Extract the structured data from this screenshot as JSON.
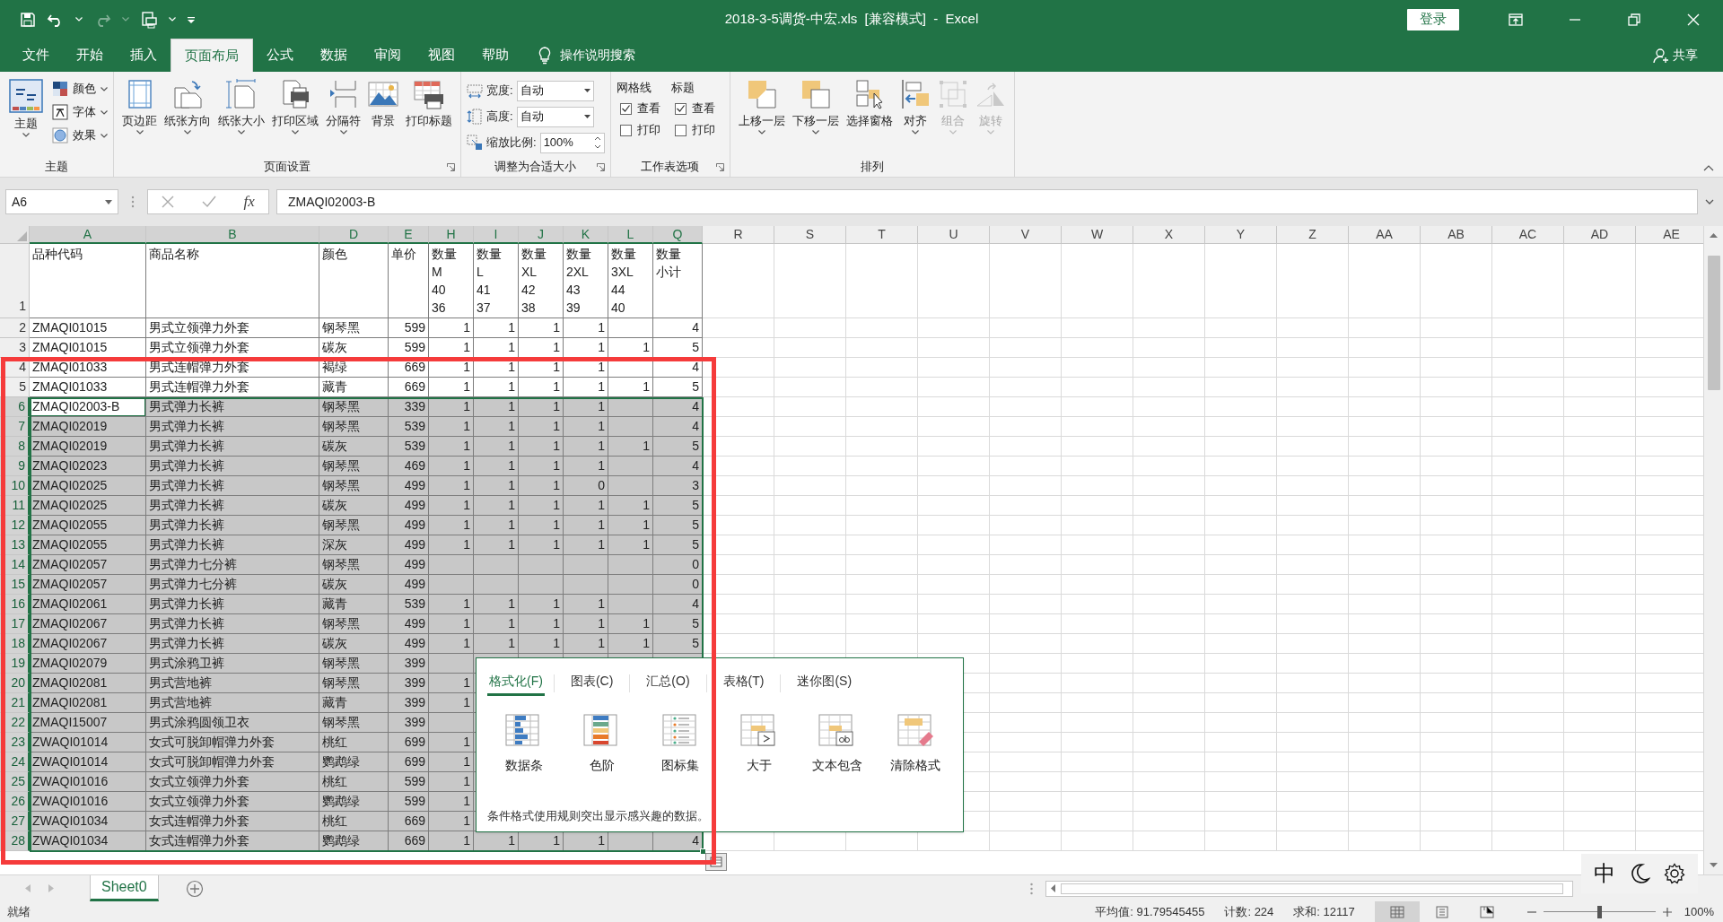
{
  "title_bar": {
    "title": "2018-3-5调货-中宏.xls  [兼容模式]  -  Excel",
    "sign_in": "登录"
  },
  "menu_tabs": [
    {
      "label": "文件",
      "selected": false
    },
    {
      "label": "开始",
      "selected": false
    },
    {
      "label": "插入",
      "selected": false
    },
    {
      "label": "页面布局",
      "selected": true
    },
    {
      "label": "公式",
      "selected": false
    },
    {
      "label": "数据",
      "selected": false
    },
    {
      "label": "审阅",
      "selected": false
    },
    {
      "label": "视图",
      "selected": false
    },
    {
      "label": "帮助",
      "selected": false
    }
  ],
  "tell_me": "操作说明搜索",
  "share": "共享",
  "ribbon": {
    "groups": [
      {
        "label": "主题",
        "kind": "theme",
        "launcher": false,
        "large": "主题",
        "small": [
          {
            "label": "颜色"
          },
          {
            "label": "字体"
          },
          {
            "label": "效果"
          }
        ]
      },
      {
        "label": "页面设置",
        "kind": "buttons",
        "launcher": true,
        "buttons": [
          {
            "label": "页边距",
            "dropdown": true,
            "disabled": false
          },
          {
            "label": "纸张方向",
            "dropdown": true,
            "disabled": false
          },
          {
            "label": "纸张大小",
            "dropdown": true,
            "disabled": false
          },
          {
            "label": "打印区域",
            "dropdown": true,
            "disabled": false
          },
          {
            "label": "分隔符",
            "dropdown": true,
            "disabled": false
          },
          {
            "label": "背景",
            "dropdown": false,
            "disabled": false
          },
          {
            "label": "打印标题",
            "dropdown": false,
            "disabled": false
          }
        ]
      },
      {
        "label": "调整为合适大小",
        "kind": "scale",
        "launcher": true,
        "fields": [
          {
            "label": "宽度:",
            "value": "自动",
            "kind": "dropdown"
          },
          {
            "label": "高度:",
            "value": "自动",
            "kind": "dropdown"
          },
          {
            "label": "缩放比例:",
            "value": "100%",
            "kind": "spinner"
          }
        ]
      },
      {
        "label": "工作表选项",
        "kind": "sheet_options",
        "launcher": true,
        "columns": [
          {
            "heading": "网格线",
            "options": [
              {
                "label": "查看",
                "checked": true
              },
              {
                "label": "打印",
                "checked": false
              }
            ]
          },
          {
            "heading": "标题",
            "options": [
              {
                "label": "查看",
                "checked": true
              },
              {
                "label": "打印",
                "checked": false
              }
            ]
          }
        ]
      },
      {
        "label": "排列",
        "kind": "buttons",
        "launcher": false,
        "buttons": [
          {
            "label": "上移一层",
            "dropdown": true,
            "disabled": false
          },
          {
            "label": "下移一层",
            "dropdown": true,
            "disabled": false
          },
          {
            "label": "选择窗格",
            "dropdown": false,
            "disabled": false
          },
          {
            "label": "对齐",
            "dropdown": true,
            "disabled": false
          },
          {
            "label": "组合",
            "dropdown": true,
            "disabled": true
          },
          {
            "label": "旋转",
            "dropdown": true,
            "disabled": true
          }
        ]
      }
    ]
  },
  "formula_bar": {
    "name_box": "A6",
    "function_symbol": "fx",
    "content": "ZMAQI02003-B"
  },
  "grid": {
    "columns": [
      {
        "letter": "A",
        "selected": true
      },
      {
        "letter": "B",
        "selected": true
      },
      {
        "letter": "D",
        "selected": true
      },
      {
        "letter": "E",
        "selected": true
      },
      {
        "letter": "H",
        "selected": true
      },
      {
        "letter": "I",
        "selected": true
      },
      {
        "letter": "J",
        "selected": true
      },
      {
        "letter": "K",
        "selected": true
      },
      {
        "letter": "L",
        "selected": true
      },
      {
        "letter": "Q",
        "selected": true
      },
      {
        "letter": "R",
        "selected": false
      },
      {
        "letter": "S",
        "selected": false
      },
      {
        "letter": "T",
        "selected": false
      },
      {
        "letter": "U",
        "selected": false
      },
      {
        "letter": "V",
        "selected": false
      },
      {
        "letter": "W",
        "selected": false
      },
      {
        "letter": "X",
        "selected": false
      },
      {
        "letter": "Y",
        "selected": false
      },
      {
        "letter": "Z",
        "selected": false
      },
      {
        "letter": "AA",
        "selected": false
      },
      {
        "letter": "AB",
        "selected": false
      },
      {
        "letter": "AC",
        "selected": false
      },
      {
        "letter": "AD",
        "selected": false
      },
      {
        "letter": "AE",
        "selected": false
      }
    ],
    "rows": [
      {
        "number": "1",
        "kind": "header",
        "selected": false,
        "active": false,
        "cells": [
          "品种代码",
          "商品名称",
          "颜色",
          "单价",
          "数量\nM\n40\n36",
          "数量\nL\n41\n37",
          "数量\nXL\n42\n38",
          "数量\n2XL\n43\n39",
          "数量\n3XL\n44\n40",
          "数量小计"
        ]
      },
      {
        "number": "2",
        "kind": "data",
        "selected": false,
        "active": false,
        "cells": [
          "ZMAQI01015",
          "男式立领弹力外套",
          "钢琴黑",
          "599",
          "1",
          "1",
          "1",
          "1",
          null,
          "4"
        ]
      },
      {
        "number": "3",
        "kind": "data",
        "selected": false,
        "active": false,
        "cells": [
          "ZMAQI01015",
          "男式立领弹力外套",
          "碳灰",
          "599",
          "1",
          "1",
          "1",
          "1",
          "1",
          "5"
        ]
      },
      {
        "number": "4",
        "kind": "data",
        "selected": false,
        "active": false,
        "cells": [
          "ZMAQI01033",
          "男式连帽弹力外套",
          "褐绿",
          "669",
          "1",
          "1",
          "1",
          "1",
          null,
          "4"
        ]
      },
      {
        "number": "5",
        "kind": "data",
        "selected": false,
        "active": false,
        "cells": [
          "ZMAQI01033",
          "男式连帽弹力外套",
          "藏青",
          "669",
          "1",
          "1",
          "1",
          "1",
          "1",
          "5"
        ]
      },
      {
        "number": "6",
        "kind": "data",
        "selected": true,
        "active": true,
        "cells": [
          "ZMAQI02003-B",
          "男式弹力长裤",
          "钢琴黑",
          "339",
          "1",
          "1",
          "1",
          "1",
          null,
          "4"
        ]
      },
      {
        "number": "7",
        "kind": "data",
        "selected": true,
        "active": false,
        "cells": [
          "ZMAQI02019",
          "男式弹力长裤",
          "钢琴黑",
          "539",
          "1",
          "1",
          "1",
          "1",
          null,
          "4"
        ]
      },
      {
        "number": "8",
        "kind": "data",
        "selected": true,
        "active": false,
        "cells": [
          "ZMAQI02019",
          "男式弹力长裤",
          "碳灰",
          "539",
          "1",
          "1",
          "1",
          "1",
          "1",
          "5"
        ]
      },
      {
        "number": "9",
        "kind": "data",
        "selected": true,
        "active": false,
        "cells": [
          "ZMAQI02023",
          "男式弹力长裤",
          "钢琴黑",
          "469",
          "1",
          "1",
          "1",
          "1",
          null,
          "4"
        ]
      },
      {
        "number": "10",
        "kind": "data",
        "selected": true,
        "active": false,
        "cells": [
          "ZMAQI02025",
          "男式弹力长裤",
          "钢琴黑",
          "499",
          "1",
          "1",
          "1",
          "0",
          null,
          "3"
        ]
      },
      {
        "number": "11",
        "kind": "data",
        "selected": true,
        "active": false,
        "cells": [
          "ZMAQI02025",
          "男式弹力长裤",
          "碳灰",
          "499",
          "1",
          "1",
          "1",
          "1",
          "1",
          "5"
        ]
      },
      {
        "number": "12",
        "kind": "data",
        "selected": true,
        "active": false,
        "cells": [
          "ZMAQI02055",
          "男式弹力长裤",
          "钢琴黑",
          "499",
          "1",
          "1",
          "1",
          "1",
          "1",
          "5"
        ]
      },
      {
        "number": "13",
        "kind": "data",
        "selected": true,
        "active": false,
        "cells": [
          "ZMAQI02055",
          "男式弹力长裤",
          "深灰",
          "499",
          "1",
          "1",
          "1",
          "1",
          "1",
          "5"
        ]
      },
      {
        "number": "14",
        "kind": "data",
        "selected": true,
        "active": false,
        "cells": [
          "ZMAQI02057",
          "男式弹力七分裤",
          "钢琴黑",
          "499",
          null,
          null,
          null,
          null,
          null,
          "0"
        ]
      },
      {
        "number": "15",
        "kind": "data",
        "selected": true,
        "active": false,
        "cells": [
          "ZMAQI02057",
          "男式弹力七分裤",
          "碳灰",
          "499",
          null,
          null,
          null,
          null,
          null,
          "0"
        ]
      },
      {
        "number": "16",
        "kind": "data",
        "selected": true,
        "active": false,
        "cells": [
          "ZMAQI02061",
          "男式弹力长裤",
          "藏青",
          "539",
          "1",
          "1",
          "1",
          "1",
          null,
          "4"
        ]
      },
      {
        "number": "17",
        "kind": "data",
        "selected": true,
        "active": false,
        "cells": [
          "ZMAQI02067",
          "男式弹力长裤",
          "钢琴黑",
          "499",
          "1",
          "1",
          "1",
          "1",
          "1",
          "5"
        ]
      },
      {
        "number": "18",
        "kind": "data",
        "selected": true,
        "active": false,
        "cells": [
          "ZMAQI02067",
          "男式弹力长裤",
          "碳灰",
          "499",
          "1",
          "1",
          "1",
          "1",
          "1",
          "5"
        ]
      },
      {
        "number": "19",
        "kind": "data",
        "selected": true,
        "active": false,
        "cells": [
          "ZMAQI02079",
          "男式涂鸦卫裤",
          "钢琴黑",
          "399",
          null,
          null,
          null,
          null,
          null,
          null
        ]
      },
      {
        "number": "20",
        "kind": "data",
        "selected": true,
        "active": false,
        "cells": [
          "ZMAQI02081",
          "男式营地裤",
          "钢琴黑",
          "399",
          "1",
          null,
          null,
          null,
          null,
          null
        ]
      },
      {
        "number": "21",
        "kind": "data",
        "selected": true,
        "active": false,
        "cells": [
          "ZMAQI02081",
          "男式营地裤",
          "藏青",
          "399",
          "1",
          null,
          null,
          null,
          null,
          null
        ]
      },
      {
        "number": "22",
        "kind": "data",
        "selected": true,
        "active": false,
        "cells": [
          "ZMAQI15007",
          "男式涂鸦圆领卫衣",
          "钢琴黑",
          "399",
          null,
          null,
          null,
          null,
          null,
          null
        ]
      },
      {
        "number": "23",
        "kind": "data",
        "selected": true,
        "active": false,
        "cells": [
          "ZWAQI01014",
          "女式可脱卸帽弹力外套",
          "桃红",
          "699",
          "1",
          null,
          null,
          null,
          null,
          null
        ]
      },
      {
        "number": "24",
        "kind": "data",
        "selected": true,
        "active": false,
        "cells": [
          "ZWAQI01014",
          "女式可脱卸帽弹力外套",
          "鹦鹉绿",
          "699",
          "1",
          null,
          null,
          null,
          null,
          null
        ]
      },
      {
        "number": "25",
        "kind": "data",
        "selected": true,
        "active": false,
        "cells": [
          "ZWAQI01016",
          "女式立领弹力外套",
          "桃红",
          "599",
          "1",
          null,
          null,
          null,
          null,
          null
        ]
      },
      {
        "number": "26",
        "kind": "data",
        "selected": true,
        "active": false,
        "cells": [
          "ZWAQI01016",
          "女式立领弹力外套",
          "鹦鹉绿",
          "599",
          "1",
          null,
          null,
          null,
          null,
          null
        ]
      },
      {
        "number": "27",
        "kind": "data",
        "selected": true,
        "active": false,
        "cells": [
          "ZWAQI01034",
          "女式连帽弹力外套",
          "桃红",
          "669",
          "1",
          null,
          null,
          null,
          null,
          null
        ]
      },
      {
        "number": "28",
        "kind": "data",
        "selected": true,
        "active": false,
        "cells": [
          "ZWAQI01034",
          "女式连帽弹力外套",
          "鹦鹉绿",
          "669",
          "1",
          "1",
          "1",
          "1",
          null,
          "4"
        ]
      }
    ]
  },
  "quick_analysis": {
    "tabs": [
      {
        "label": "格式化(F)",
        "selected": true
      },
      {
        "label": "图表(C)",
        "selected": false
      },
      {
        "label": "汇总(O)",
        "selected": false
      },
      {
        "label": "表格(T)",
        "selected": false
      },
      {
        "label": "迷你图(S)",
        "selected": false
      }
    ],
    "items": [
      {
        "label": "数据条"
      },
      {
        "label": "色阶"
      },
      {
        "label": "图标集"
      },
      {
        "label": "大于"
      },
      {
        "label": "文本包含"
      },
      {
        "label": "清除格式"
      }
    ],
    "description": "条件格式使用规则突出显示感兴趣的数据。"
  },
  "sheet_tabs": [
    {
      "label": "Sheet0",
      "selected": true
    }
  ],
  "ime": {
    "mode": "中"
  },
  "status_bar": {
    "ready": "就绪",
    "stats": [
      "平均值: 91.79545455",
      "计数: 224",
      "求和: 12117"
    ],
    "views": [
      {
        "selected": true
      },
      {
        "selected": false
      },
      {
        "selected": false
      }
    ],
    "zoom": {
      "level": 0.5,
      "reading": "100%"
    }
  }
}
